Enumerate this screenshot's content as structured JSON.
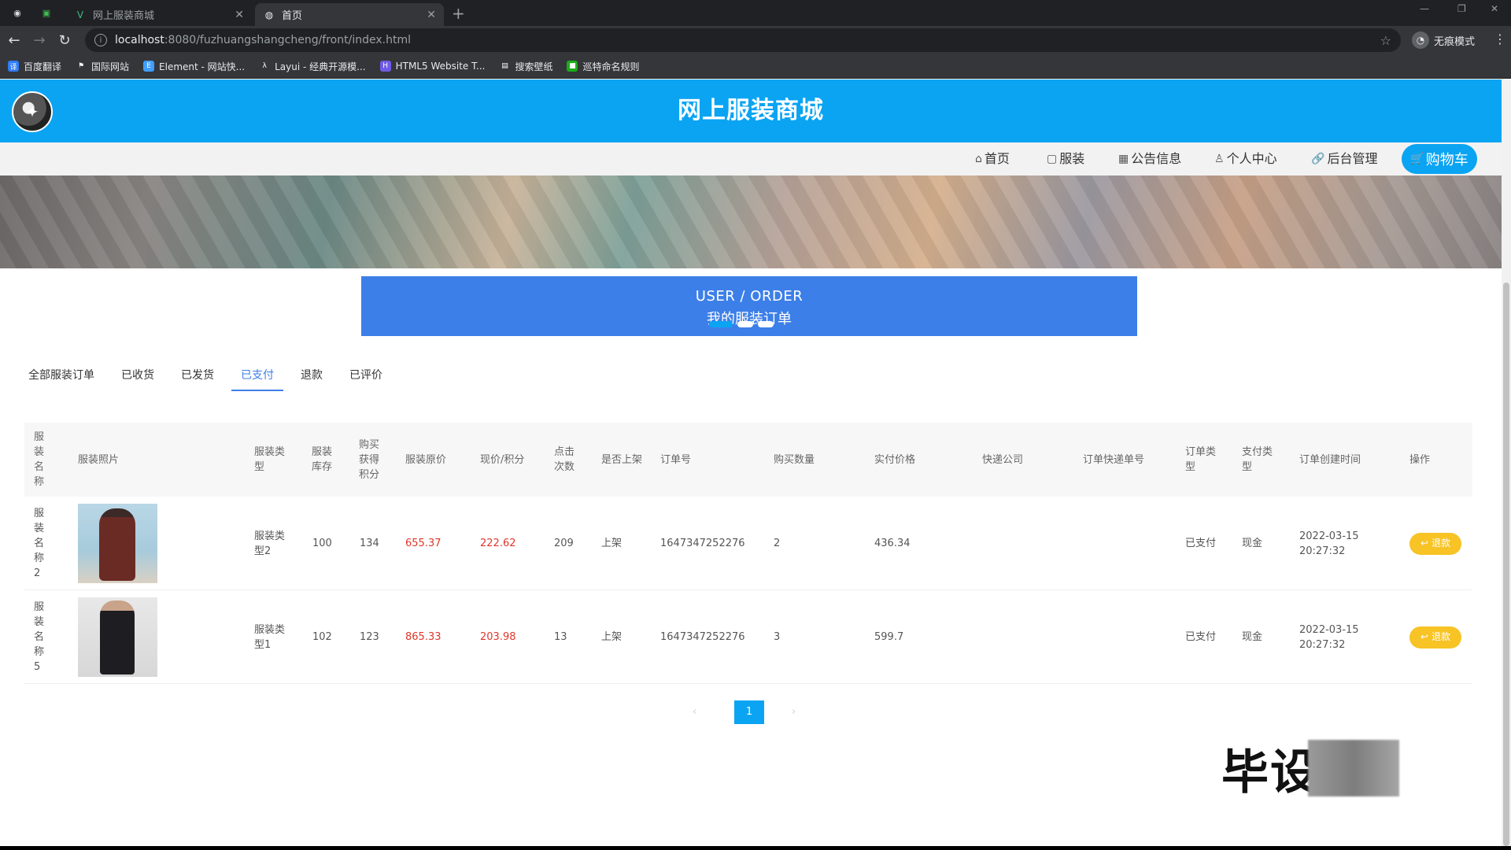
{
  "browser": {
    "tabs": [
      {
        "title": "网上服装商城",
        "active": false
      },
      {
        "title": "首页",
        "active": true
      }
    ],
    "url_host": "localhost",
    "url_path": ":8080/fuzhuangshangcheng/front/index.html",
    "profile_label": "无痕模式",
    "bookmarks": [
      "百度翻译",
      "国际网站",
      "Element - 网站快...",
      "Layui - 经典开源模...",
      "HTML5 Website T...",
      "搜索壁纸",
      "巡特命名规则"
    ]
  },
  "site": {
    "title": "网上服装商城",
    "nav": [
      "首页",
      "服装",
      "公告信息",
      "个人中心",
      "后台管理"
    ],
    "cart_label": "购物车"
  },
  "order_banner": {
    "en": "USER / ORDER",
    "zh": "我的服装订单"
  },
  "filter_tabs": [
    "全部服装订单",
    "已收货",
    "已发货",
    "已支付",
    "退款",
    "已评价"
  ],
  "active_filter_tab": "已支付",
  "table": {
    "headers": [
      "服装名称",
      "服装照片",
      "服装类型",
      "服装库存",
      "购买获得积分",
      "服装原价",
      "现价/积分",
      "点击次数",
      "是否上架",
      "订单号",
      "购买数量",
      "实付价格",
      "快递公司",
      "订单快递单号",
      "订单类型",
      "支付类型",
      "订单创建时间",
      "操作"
    ],
    "rows": [
      {
        "name": "服装名称2",
        "type": "服装类型2",
        "stock": "100",
        "points": "134",
        "orig": "655.37",
        "price": "222.62",
        "clicks": "209",
        "listed": "上架",
        "order_no": "1647347252276",
        "qty": "2",
        "paid": "436.34",
        "courier": "",
        "tracking": "",
        "order_type": "已支付",
        "pay_type": "现金",
        "created_date": "2022-03-15",
        "created_time": "20:27:32",
        "op": "退款"
      },
      {
        "name": "服装名称5",
        "type": "服装类型1",
        "stock": "102",
        "points": "123",
        "orig": "865.33",
        "price": "203.98",
        "clicks": "13",
        "listed": "上架",
        "order_no": "1647347252276",
        "qty": "3",
        "paid": "599.7",
        "courier": "",
        "tracking": "",
        "order_type": "已支付",
        "pay_type": "现金",
        "created_date": "2022-03-15",
        "created_time": "20:27:32",
        "op": "退款"
      }
    ]
  },
  "pager": {
    "current": "1"
  },
  "watermark": "毕设"
}
